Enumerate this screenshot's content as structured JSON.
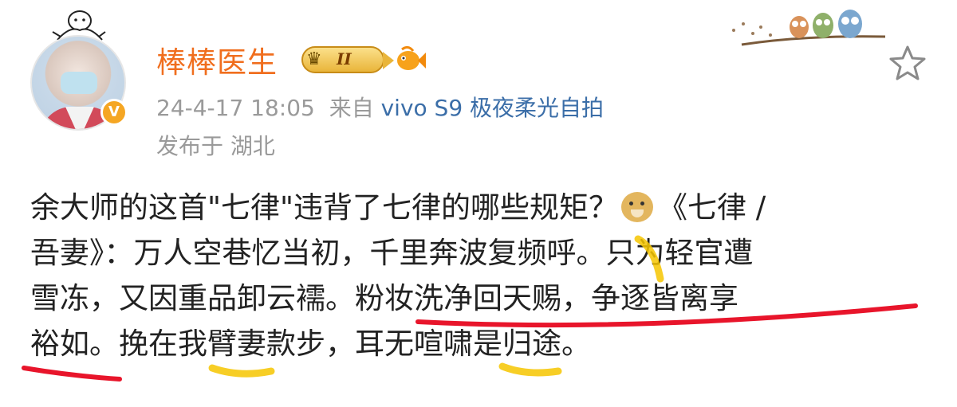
{
  "user": {
    "name": "棒棒医生",
    "level": "II"
  },
  "post": {
    "timestamp": "24-4-17 18:05",
    "source_prefix": "来自",
    "source": "vivo S9 极夜柔光自拍",
    "location": "发布于 湖北",
    "text_lines": [
      {
        "before": "余大师的这首\"七律\"违背了七律的哪些规矩？",
        "after": "《七律 /"
      },
      {
        "text": "吾妻》：万人空巷忆当初，千里奔波复频呼。只为轻官遭"
      },
      {
        "text": "雪冻，又因重品卸云襦。粉妆洗净回天赐，争逐皆离享"
      },
      {
        "text": "裕如。挽在我臂妻款步，耳无喧啸是归途。"
      }
    ]
  },
  "icons": {
    "verified": "verified-badge-icon",
    "star": "star-icon",
    "emoji": "doge-emoji-icon"
  },
  "colors": {
    "username": "#f06e1e",
    "meta": "#9a9a9a",
    "source_link": "#3b6ea8",
    "red_underline": "#e8152b",
    "yellow_highlight": "#f6c500"
  }
}
